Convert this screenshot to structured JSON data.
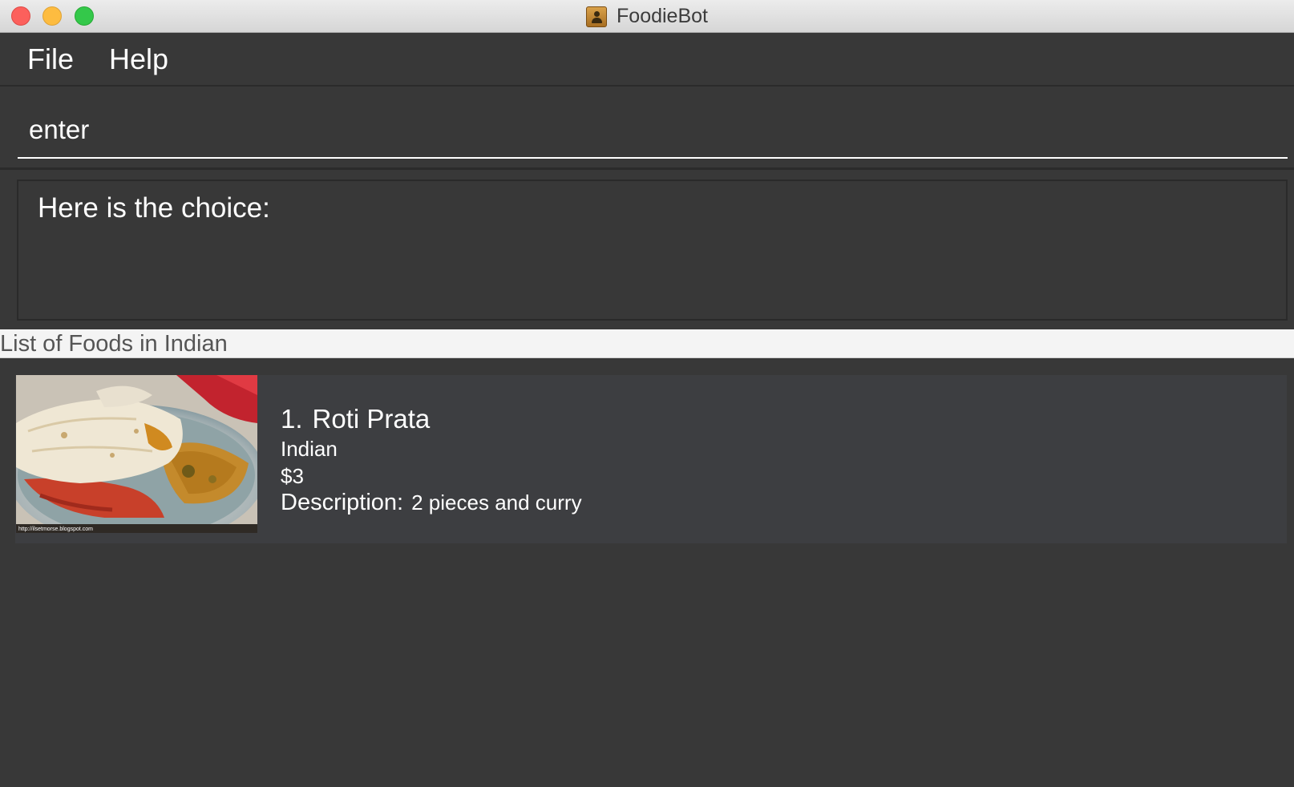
{
  "window": {
    "title": "FoodieBot",
    "app_icon": "contacts-book-icon",
    "traffic_lights": {
      "close": "#fc605c",
      "minimize": "#fdbc40",
      "zoom": "#34c84a"
    }
  },
  "menu": {
    "items": [
      {
        "label": "File"
      },
      {
        "label": "Help"
      }
    ]
  },
  "command": {
    "value": "enter"
  },
  "result": {
    "text": "Here is the choice:"
  },
  "list": {
    "header": "List of Foods in Indian",
    "foods": [
      {
        "index": "1.",
        "name": "Roti Prata",
        "cuisine": "Indian",
        "price": "$3",
        "description_label": "Description:",
        "description": "2 pieces and curry",
        "image_watermark": "http://ilsetmorse.blogspot.com"
      }
    ]
  },
  "colors": {
    "background": "#383838",
    "card": "#3d3e41",
    "text": "#ffffff",
    "header_bar": "#f4f4f4"
  }
}
